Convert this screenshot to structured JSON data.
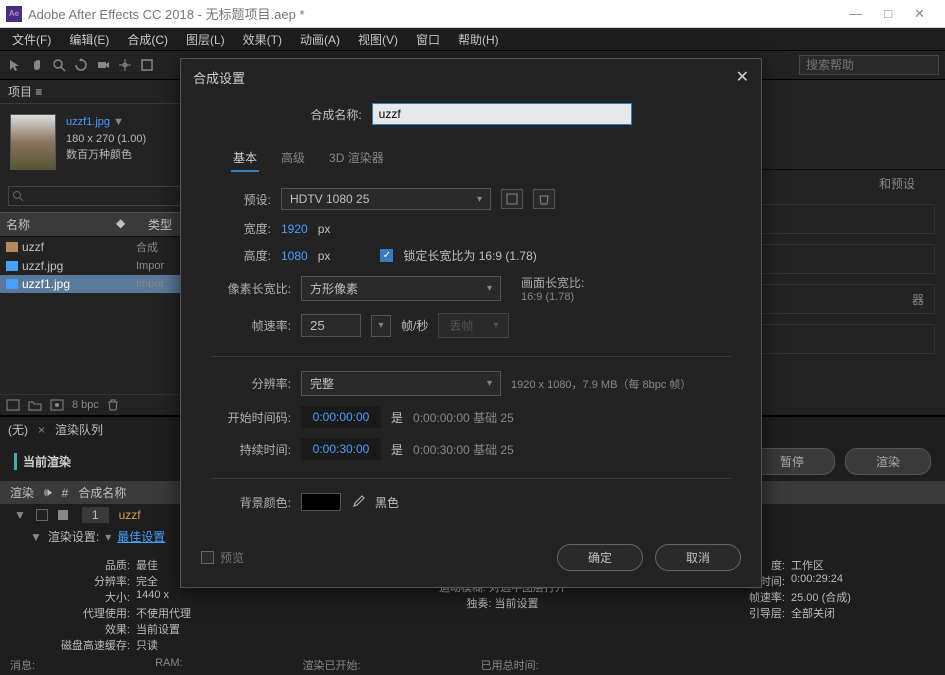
{
  "window": {
    "app_logo": "Ae",
    "title": "Adobe After Effects CC 2018 - 无标题项目.aep *"
  },
  "menubar": {
    "file": "文件(F)",
    "edit": "编辑(E)",
    "composition": "合成(C)",
    "layer": "图层(L)",
    "effect": "效果(T)",
    "animation": "动画(A)",
    "view": "视图(V)",
    "window": "窗口",
    "help": "帮助(H)"
  },
  "toolbar": {
    "search_placeholder": "搜索帮助"
  },
  "project": {
    "tab": "项目 ≡",
    "selected_name": "uzzf1.jpg",
    "selected_arrow": "▼",
    "selected_dims": "180 x 270 (1.00)",
    "selected_colors": "数百万种颜色",
    "columns": {
      "name": "名称",
      "tag": "◆",
      "type": "类型"
    },
    "rows": [
      {
        "icon": "comp",
        "name": "uzzf",
        "type": "合成",
        "selected": false
      },
      {
        "icon": "img",
        "name": "uzzf.jpg",
        "type": "Impor",
        "selected": false
      },
      {
        "icon": "img",
        "name": "uzzf1.jpg",
        "type": "Impor",
        "selected": true
      }
    ],
    "footer_bpc": "8 bpc"
  },
  "right": {
    "preset_hint": "和预设",
    "accordion_end": "器",
    "pause": "暂停",
    "render": "渲染"
  },
  "render_queue": {
    "left_tab": "(无)",
    "tab": "渲染队列",
    "current": "当前渲染",
    "col_render": "渲染",
    "col_num": "#",
    "col_compname": "合成名称",
    "row_num": "1",
    "row_name": "uzzf",
    "settings_label": "渲染设置:",
    "settings_value": "最佳设置"
  },
  "stats": {
    "left": [
      {
        "label": "品质:",
        "value": "最佳"
      },
      {
        "label": "分辨率:",
        "value": "完全"
      },
      {
        "label": "大小:",
        "value": "1440 x"
      },
      {
        "label": "代理使用:",
        "value": "不使用代理"
      },
      {
        "label": "效果:",
        "value": "当前设置"
      },
      {
        "label": "磁盘高速缓存:",
        "value": "只读"
      }
    ],
    "center": [
      "运动模糊: 对选中图层打开",
      "独奏: 当前设置"
    ],
    "right": [
      {
        "label": "度:",
        "value": "工作区"
      },
      {
        "label": "时间:",
        "value": "0:00:29:24"
      },
      {
        "label": "帧速率:",
        "value": "25.00 (合成)"
      },
      {
        "label": "引导层:",
        "value": "全部关闭"
      }
    ]
  },
  "bottombar": {
    "msg": "消息:",
    "ram": "RAM:",
    "render_done": "渲染已开始:",
    "total": "已用总时间:"
  },
  "dialog": {
    "title": "合成设置",
    "name_label": "合成名称:",
    "name_value": "uzzf",
    "tabs": {
      "basic": "基本",
      "advanced": "高级",
      "renderer": "3D 渲染器"
    },
    "preset_label": "预设:",
    "preset_value": "HDTV 1080 25",
    "width_label": "宽度:",
    "width_value": "1920",
    "px": "px",
    "height_label": "高度:",
    "height_value": "1080",
    "lock_aspect": "锁定长宽比为 16:9 (1.78)",
    "pixel_aspect_label": "像素长宽比:",
    "pixel_aspect_value": "方形像素",
    "frame_aspect_label": "画面长宽比:",
    "frame_aspect_value": "16:9 (1.78)",
    "framerate_label": "帧速率:",
    "framerate_value": "25",
    "fps_unit": "帧/秒",
    "drop_disabled": "丢帧",
    "resolution_label": "分辨率:",
    "resolution_value": "完整",
    "resolution_info": "1920 x 1080，7.9 MB（每 8bpc 帧）",
    "start_tc_label": "开始时间码:",
    "start_tc_value": "0:00:00:00",
    "is": "是",
    "start_tc_base": "0:00:00:00 基础 25",
    "duration_label": "持续时间:",
    "duration_value": "0:00:30:00",
    "duration_base": "0:00:30:00 基础 25",
    "bg_label": "背景颜色:",
    "bg_name": "黑色",
    "preview": "预览",
    "ok": "确定",
    "cancel": "取消"
  }
}
